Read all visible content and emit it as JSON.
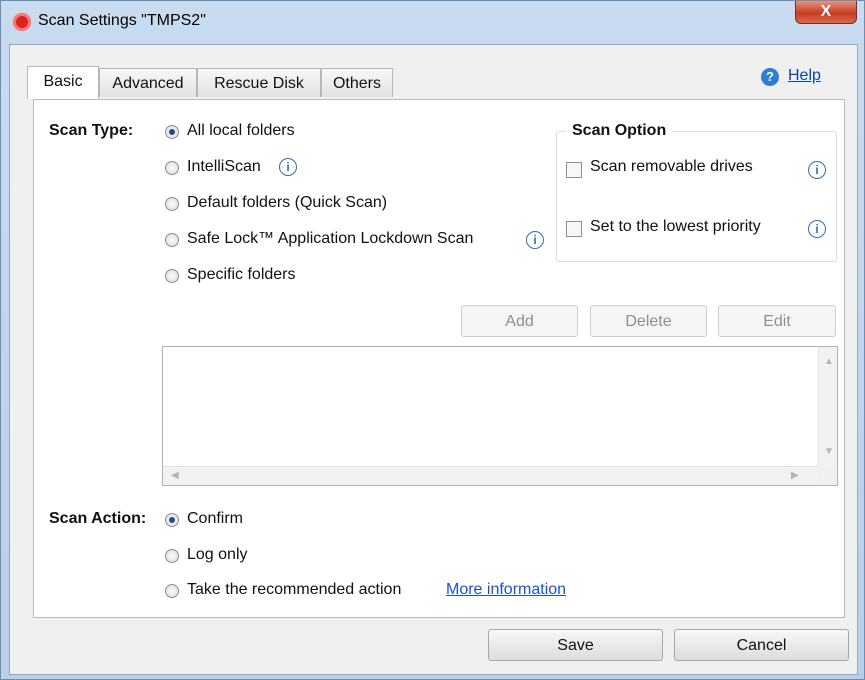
{
  "window": {
    "title": "Scan Settings \"TMPS2\"",
    "close_label": "X"
  },
  "tabs": [
    "Basic",
    "Advanced",
    "Rescue Disk",
    "Others"
  ],
  "help": {
    "label": "Help"
  },
  "scan_type": {
    "label": "Scan Type:",
    "options": [
      "All local folders",
      "IntelliScan",
      "Default folders (Quick Scan)",
      "Safe Lock™ Application Lockdown Scan",
      "Specific folders"
    ],
    "selected": "All local folders"
  },
  "scan_option": {
    "title": "Scan Option",
    "items": [
      "Scan removable drives",
      "Set to the lowest priority"
    ]
  },
  "folder_buttons": {
    "add": "Add",
    "delete": "Delete",
    "edit": "Edit"
  },
  "scan_action": {
    "label": "Scan Action:",
    "options": [
      "Confirm",
      "Log only",
      "Take the recommended action"
    ],
    "selected": "Confirm",
    "more_info": "More information"
  },
  "footer": {
    "save": "Save",
    "cancel": "Cancel"
  },
  "icons": {
    "info": "info-icon",
    "help": "help-icon",
    "app": "app-icon"
  },
  "colors": {
    "link": "#1b4fe0",
    "radio_selected": "#1d4e94",
    "close_button": "#c53c22",
    "info": "#2f6fba"
  }
}
